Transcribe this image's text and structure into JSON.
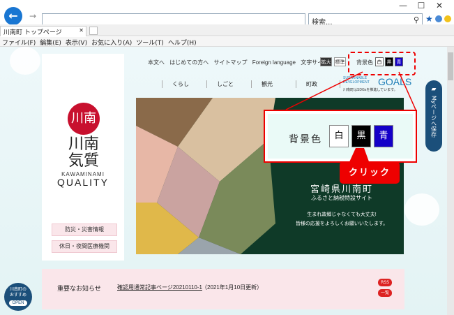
{
  "browser": {
    "search_placeholder": "検索...",
    "tab_title": "川南町 トップページ",
    "menu": [
      "ファイル(F)",
      "編集(E)",
      "表示(V)",
      "お気に入り(A)",
      "ツール(T)",
      "ヘルプ(H)"
    ],
    "window_controls": [
      "—",
      "☐",
      "✕"
    ]
  },
  "header": {
    "links": [
      "本文へ",
      "はじめての方へ",
      "サイトマップ",
      "Foreign language",
      "文字サイズ"
    ],
    "size_large": "拡大",
    "size_standard": "標準",
    "bg_label": "背景色",
    "bg_white": "白",
    "bg_black": "黒",
    "bg_blue": "青"
  },
  "nav": [
    "くらし",
    "しごと",
    "観光",
    "町政"
  ],
  "sdgs": {
    "line1": "SUSTAINABLE",
    "line2": "DEVELOPMENT",
    "big": "GOALS",
    "line3": "川南町はSDGsを推進しています。"
  },
  "logo": {
    "seal": "川南",
    "title": "川南気質",
    "roman": "KAWAMINAMI",
    "quality": "QUALITY"
  },
  "left_buttons": [
    "防災・災害情報",
    "休日・夜間医療機関"
  ],
  "mypage": {
    "label": "Myページへ保存"
  },
  "hero": {
    "title": "宮崎県川南町",
    "subtitle": "ふるさと納税特設サイト",
    "message1": "生まれ故郷じゃなくても大丈夫!",
    "message2": "皆様の応援をよろしくお願いいたします。"
  },
  "zoom": {
    "label": "背景色",
    "white": "白",
    "black": "黒",
    "blue": "青",
    "callout": "クリック"
  },
  "notice": {
    "heading": "重要なお知らせ",
    "link": "確認用通常記事ページ20210110-1",
    "date": "（2021年1月10日更新）",
    "rss": "RSS",
    "list": "一覧"
  },
  "badge": {
    "line1": "川南町の",
    "line2": "おすすめ",
    "open": "OPEN"
  },
  "colors": {
    "accent_red": "#e00000",
    "navy": "#1b4f7a",
    "hero_green": "#0f3a28",
    "pink": "#fae6ea",
    "blue_button": "#1400c8"
  }
}
